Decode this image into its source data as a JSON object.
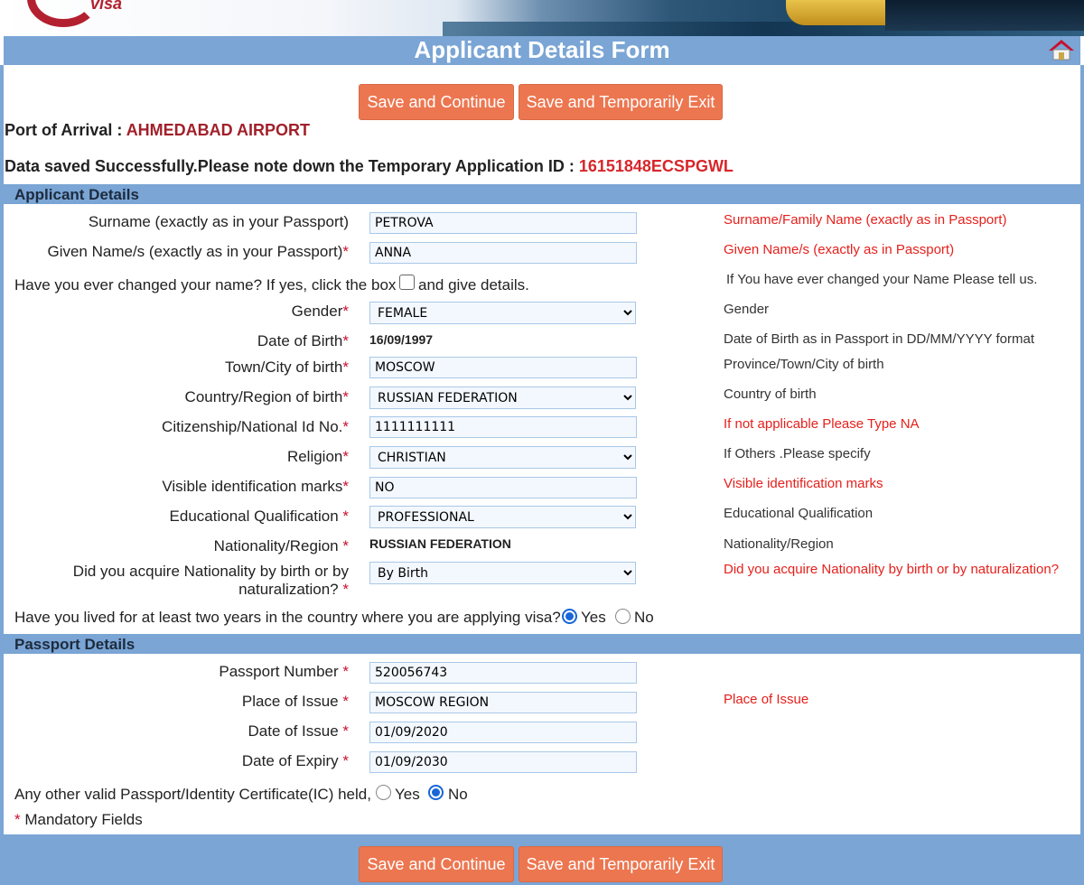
{
  "page": {
    "title": "Applicant Details Form",
    "logo_text": "visa"
  },
  "buttons": {
    "save_continue": "Save and Continue",
    "save_exit": "Save and Temporarily Exit"
  },
  "port": {
    "label": "Port of Arrival : ",
    "value": "AHMEDABAD AIRPORT"
  },
  "saved": {
    "message": "Data saved Successfully.Please note down the Temporary Application ID : ",
    "id": "16151848ECSPGWL"
  },
  "applicant": {
    "header": "Applicant Details",
    "surname": {
      "label": "Surname (exactly as in your Passport)",
      "value": "PETROVA",
      "hint": "Surname/Family Name (exactly as in Passport)"
    },
    "given": {
      "label": "Given Name/s (exactly as in your Passport)",
      "value": "ANNA",
      "hint": "Given Name/s (exactly as in Passport)"
    },
    "changed": {
      "before": "Have you ever changed your name? If yes, click the box",
      "after": "and give details.",
      "hint": "If You have ever changed your Name Please tell us."
    },
    "gender": {
      "label": "Gender",
      "value": "FEMALE",
      "hint": "Gender"
    },
    "dob": {
      "label": "Date of Birth",
      "value": "16/09/1997",
      "hint": "Date of Birth as in Passport in DD/MM/YYYY format"
    },
    "town": {
      "label": "Town/City of birth",
      "value": "MOSCOW",
      "hint": "Province/Town/City of birth"
    },
    "country": {
      "label": "Country/Region of birth",
      "value": "RUSSIAN FEDERATION",
      "hint": "Country of birth"
    },
    "citizenship": {
      "label": "Citizenship/National Id No.",
      "value": "1111111111",
      "hint": "If not applicable Please Type NA"
    },
    "religion": {
      "label": "Religion",
      "value": "CHRISTIAN",
      "hint": "If Others .Please specify"
    },
    "marks": {
      "label": "Visible identification marks",
      "value": "NO",
      "hint": "Visible identification marks"
    },
    "education": {
      "label": "Educational Qualification ",
      "value": "PROFESSIONAL",
      "hint": "Educational Qualification"
    },
    "nationality": {
      "label": "Nationality/Region ",
      "value": "RUSSIAN FEDERATION",
      "hint": "Nationality/Region"
    },
    "acquire": {
      "label_line1": "Did you acquire Nationality by birth or by",
      "label_line2": "naturalization? ",
      "value": "By Birth",
      "hint": "Did you acquire Nationality by birth or by naturalization?"
    },
    "lived": {
      "question": "Have you lived for at least two years in the country where you are applying visa?",
      "yes": "Yes",
      "no": "No",
      "selected": "Yes"
    }
  },
  "passport": {
    "header": "Passport Details",
    "number": {
      "label": "Passport Number ",
      "value": "520056743"
    },
    "place": {
      "label": "Place of Issue ",
      "value": "MOSCOW REGION",
      "hint": "Place of Issue"
    },
    "issue": {
      "label": "Date of Issue ",
      "value": "01/09/2020"
    },
    "expiry": {
      "label": "Date of Expiry ",
      "value": "01/09/2030"
    },
    "other": {
      "question": "Any other valid Passport/Identity Certificate(IC) held,",
      "yes": "Yes",
      "no": "No",
      "selected": "No"
    }
  },
  "mandatory": {
    "star": "*",
    "text": " Mandatory Fields"
  },
  "required_mark": "*",
  "colors": {
    "header_bar": "#7aa5d5",
    "button": "#ec7650",
    "accent_red": "#e5201c",
    "radio": "#1866d8"
  }
}
